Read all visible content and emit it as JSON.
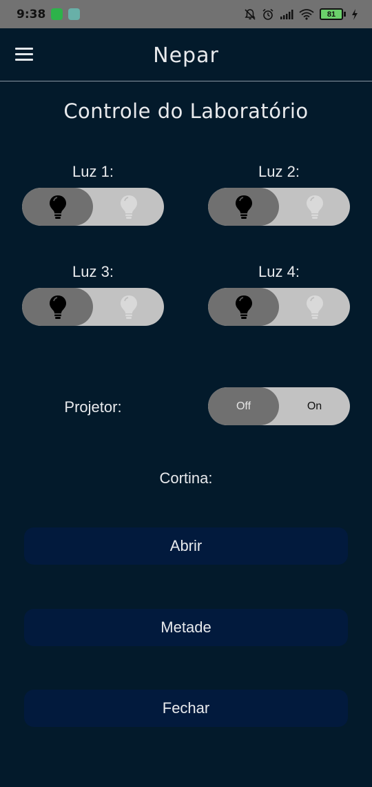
{
  "status_bar": {
    "time": "9:38",
    "battery": "81",
    "icons": [
      "whatsapp-icon",
      "app-notification-icon",
      "notifications-off-icon",
      "alarm-icon",
      "signal-icon",
      "wifi-icon",
      "battery-icon",
      "charging-icon"
    ]
  },
  "app_bar": {
    "title": "Nepar",
    "menu_icon": "hamburger-menu-icon"
  },
  "page": {
    "title": "Controle do Laboratório"
  },
  "lights": [
    {
      "label": "Luz 1:",
      "state": "off"
    },
    {
      "label": "Luz 2:",
      "state": "off"
    },
    {
      "label": "Luz 3:",
      "state": "off"
    },
    {
      "label": "Luz 4:",
      "state": "off"
    }
  ],
  "projector": {
    "label": "Projetor:",
    "off_label": "Off",
    "on_label": "On",
    "state": "off"
  },
  "curtain": {
    "label": "Cortina:",
    "buttons": [
      "Abrir",
      "Metade",
      "Fechar"
    ]
  },
  "colors": {
    "background": "#031a2b",
    "button_bg": "#021a3d",
    "toggle_track": "#c2c2c2",
    "toggle_active": "#707070",
    "status_bar": "#727272",
    "text": "#e8eaed"
  }
}
